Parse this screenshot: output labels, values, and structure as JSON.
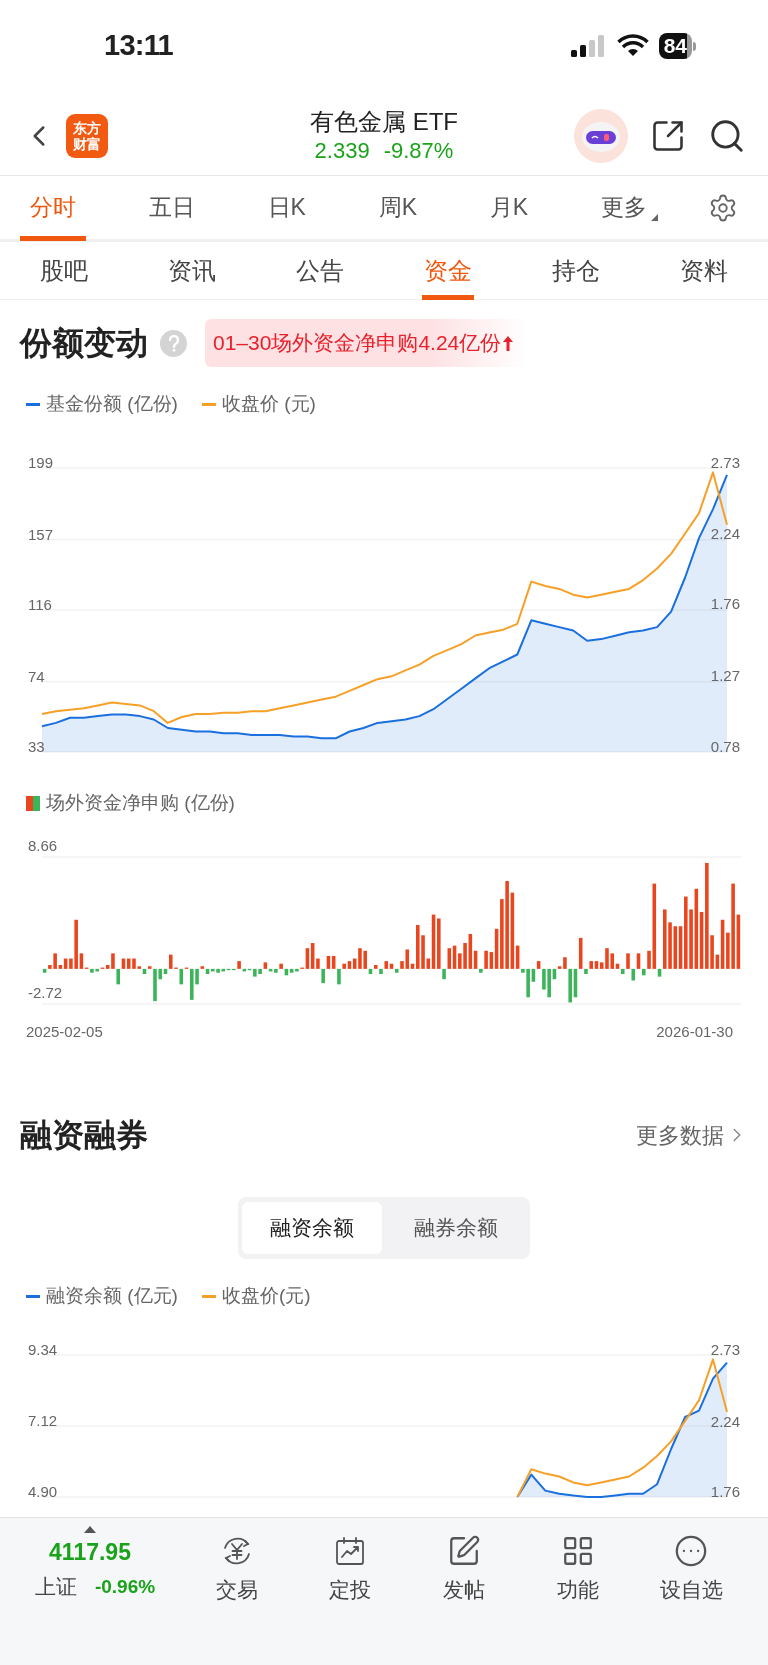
{
  "status_bar": {
    "time": "13:11",
    "battery": "84"
  },
  "header": {
    "logo_text": [
      "东方",
      "财富"
    ],
    "title": "有色金属 ETF",
    "price": "2.339",
    "change": "-9.87%"
  },
  "period_tabs": [
    {
      "label": "分时",
      "selected": true,
      "has_menu": false
    },
    {
      "label": "五日",
      "selected": false,
      "has_menu": false
    },
    {
      "label": "日K",
      "selected": false,
      "has_menu": false
    },
    {
      "label": "周K",
      "selected": false,
      "has_menu": false
    },
    {
      "label": "月K",
      "selected": false,
      "has_menu": false
    },
    {
      "label": "更多",
      "selected": false,
      "has_menu": true
    }
  ],
  "category_tabs": [
    {
      "label": "股吧",
      "selected": false
    },
    {
      "label": "资讯",
      "selected": false
    },
    {
      "label": "公告",
      "selected": false
    },
    {
      "label": "资金",
      "selected": true
    },
    {
      "label": "持仓",
      "selected": false
    },
    {
      "label": "资料",
      "selected": false
    }
  ],
  "share_change": {
    "title": "份额变动",
    "badge": {
      "text": "01–30场外资金净申购4.24亿份"
    },
    "chart_data": {
      "type": "line",
      "grid": true,
      "ylim": [
        33,
        199
      ],
      "yticks": [
        199,
        157,
        116,
        74,
        33
      ],
      "y2lim": [
        0.78,
        2.73
      ],
      "y2ticks": [
        2.73,
        2.24,
        1.76,
        1.27,
        0.78
      ],
      "series": [
        {
          "name": "基金份额 (亿份)",
          "color": "#1a6fdf",
          "type": "area",
          "values": [
            48,
            50,
            53,
            53,
            54,
            55,
            55,
            54,
            52,
            47,
            46,
            45,
            45,
            44,
            44,
            43,
            43,
            43,
            42,
            42,
            41,
            41,
            45,
            47,
            50,
            51,
            52,
            54,
            58,
            64,
            70,
            76,
            82,
            86,
            90,
            110,
            108,
            106,
            104,
            98,
            99,
            101,
            103,
            104,
            106,
            115,
            135,
            158,
            175,
            195
          ]
        },
        {
          "name": "收盘价 (元)",
          "color": "#f7a028",
          "type": "line",
          "axis": "y2",
          "values": [
            1.04,
            1.06,
            1.07,
            1.08,
            1.1,
            1.12,
            1.11,
            1.1,
            1.06,
            0.98,
            1.02,
            1.04,
            1.04,
            1.05,
            1.05,
            1.06,
            1.06,
            1.08,
            1.1,
            1.12,
            1.14,
            1.16,
            1.2,
            1.24,
            1.28,
            1.3,
            1.34,
            1.38,
            1.44,
            1.48,
            1.52,
            1.58,
            1.6,
            1.62,
            1.66,
            1.95,
            1.92,
            1.9,
            1.86,
            1.84,
            1.86,
            1.88,
            1.9,
            1.96,
            2.04,
            2.14,
            2.28,
            2.42,
            2.7,
            2.34
          ]
        }
      ]
    }
  },
  "net_subscription": {
    "date_start": "2025-02-05",
    "date_end": "2026-01-30",
    "chart_data": {
      "type": "bar",
      "stacked": true,
      "ylim": [
        -2.72,
        8.66
      ],
      "yticks": [
        8.66,
        -2.72
      ],
      "series": [
        {
          "name": "场外资金净申购 (亿份)",
          "color": "#e8461e",
          "values": [
            null,
            0.3,
            1.2,
            0.3,
            0.8,
            0.8,
            3.8,
            1.2,
            0.1,
            null,
            null,
            0.1,
            0.3,
            1.2,
            null,
            0.8,
            0.8,
            0.8,
            0.2,
            null,
            0.2,
            null,
            null,
            null,
            1.1,
            0.1,
            null,
            0.1,
            null,
            null,
            0.2,
            null,
            null,
            null,
            null,
            null,
            null,
            0.6,
            null,
            null,
            null,
            null,
            0.5,
            null,
            null,
            0.4,
            null,
            null,
            null,
            0.1,
            1.6,
            2,
            0.8,
            null,
            1,
            1,
            null,
            0.4,
            0.6,
            0.8,
            1.6,
            1.4,
            null,
            0.3,
            null,
            0.6,
            0.4,
            null,
            0.6,
            1.5,
            0.4,
            3.4,
            2.6,
            0.8,
            4.2,
            3.9,
            null,
            1.6,
            1.8,
            1.2,
            2,
            2.7,
            1.4,
            null,
            1.4,
            1.3,
            3.1,
            5.4,
            6.8,
            5.9,
            1.8,
            null,
            null,
            null,
            0.6,
            null,
            null,
            null,
            0.2,
            0.9,
            null,
            null,
            2.4,
            null,
            0.6,
            0.6,
            0.5,
            1.6,
            1.2,
            0.4,
            null,
            1.2,
            null,
            1.2,
            null,
            1.4,
            6.6,
            null,
            4.6,
            3.6,
            3.3,
            3.3,
            5.6,
            4.6,
            6.2,
            4.4,
            8.2,
            2.6,
            1.1,
            3.8,
            2.8,
            6.6,
            4.2
          ]
        },
        {
          "color": "#3cb55a",
          "values": [
            -0.3,
            null,
            null,
            null,
            null,
            null,
            null,
            null,
            null,
            -0.3,
            -0.2,
            null,
            null,
            null,
            -1.2,
            null,
            null,
            null,
            null,
            -0.4,
            null,
            -2.5,
            -0.8,
            -0.4,
            null,
            null,
            -1.2,
            null,
            -2.4,
            -1.2,
            null,
            -0.4,
            -0.2,
            -0.3,
            -0.2,
            -0.1,
            -0.1,
            null,
            -0.2,
            -0.1,
            -0.6,
            -0.4,
            null,
            -0.2,
            -0.3,
            null,
            -0.5,
            -0.3,
            -0.2,
            null,
            null,
            null,
            null,
            -1.1,
            null,
            null,
            -1.2,
            null,
            null,
            null,
            null,
            null,
            -0.4,
            null,
            -0.4,
            null,
            null,
            -0.3,
            null,
            null,
            null,
            null,
            null,
            null,
            null,
            null,
            -0.8,
            null,
            null,
            null,
            null,
            null,
            null,
            -0.3,
            null,
            null,
            null,
            null,
            null,
            null,
            null,
            -0.3,
            -2.2,
            -1,
            null,
            -1.6,
            -2.2,
            -0.8,
            null,
            null,
            -2.6,
            -2.2,
            null,
            -0.4,
            null,
            null,
            null,
            null,
            null,
            null,
            -0.4,
            null,
            -0.9,
            null,
            -0.5,
            null,
            null,
            -0.6,
            null,
            null,
            null,
            null,
            null,
            null,
            null,
            null,
            null,
            null,
            null,
            null,
            null,
            null,
            null
          ]
        }
      ]
    }
  },
  "margin": {
    "title": "融资融券",
    "more_link": "更多数据",
    "segments": [
      {
        "label": "融资余额",
        "selected": true
      },
      {
        "label": "融券余额",
        "selected": false
      }
    ],
    "chart_data": {
      "type": "line",
      "grid": true,
      "ylim": [
        4.9,
        9.34
      ],
      "yticks": [
        9.34,
        7.12,
        {
          "value": 4.9,
          "label": "4.90"
        }
      ],
      "y2lim": [
        1.76,
        2.73
      ],
      "y2ticks": [
        2.73,
        2.24,
        1.76
      ],
      "series": [
        {
          "name": "融资余额 (亿元)",
          "color": "#1a6fdf",
          "type": "area",
          "values": [
            null,
            null,
            null,
            null,
            null,
            null,
            null,
            null,
            null,
            null,
            null,
            null,
            null,
            null,
            null,
            null,
            null,
            null,
            null,
            null,
            null,
            null,
            null,
            null,
            null,
            null,
            null,
            null,
            null,
            null,
            null,
            null,
            null,
            null,
            4.9,
            5.6,
            5.1,
            5,
            4.95,
            4.9,
            4.9,
            4.95,
            5,
            5,
            5.3,
            6.4,
            7.4,
            7.6,
            8.6,
            9.1
          ]
        },
        {
          "name": "收盘价(元)",
          "color": "#f7a028",
          "type": "line",
          "axis": "y2",
          "values": [
            null,
            null,
            null,
            null,
            null,
            null,
            null,
            null,
            null,
            null,
            null,
            null,
            null,
            null,
            null,
            null,
            null,
            null,
            null,
            null,
            null,
            null,
            null,
            null,
            null,
            null,
            null,
            null,
            null,
            null,
            null,
            null,
            null,
            null,
            1.76,
            1.95,
            1.92,
            1.9,
            1.86,
            1.84,
            1.86,
            1.88,
            1.9,
            1.96,
            2.04,
            2.14,
            2.28,
            2.42,
            2.7,
            2.34
          ]
        }
      ]
    }
  },
  "bottom_bar": {
    "index": {
      "value": "4117.95",
      "name": "上证",
      "change": "-0.96%"
    },
    "items": [
      {
        "kind": "trade",
        "label": "交易"
      },
      {
        "kind": "invest",
        "label": "定投"
      },
      {
        "kind": "post",
        "label": "发帖"
      },
      {
        "kind": "functions",
        "label": "功能"
      },
      {
        "kind": "watchlist",
        "label": "设自选"
      }
    ]
  }
}
